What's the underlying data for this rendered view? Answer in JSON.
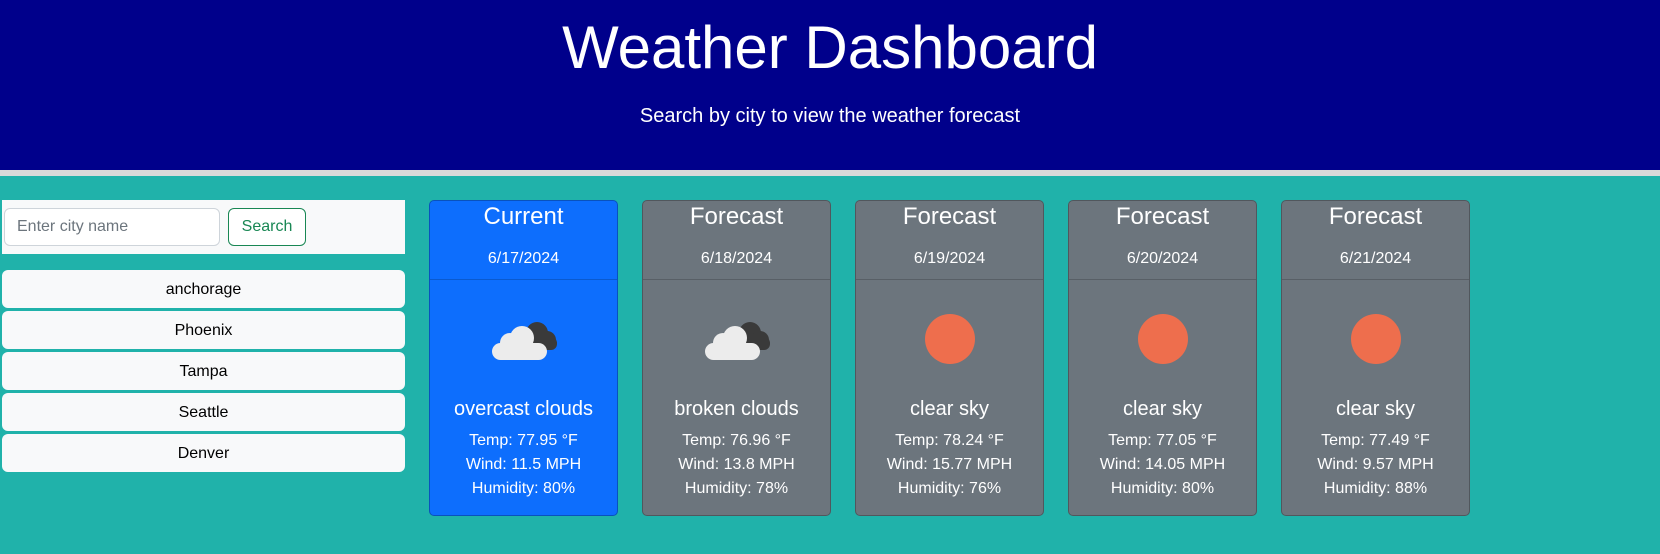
{
  "header": {
    "title": "Weather Dashboard",
    "subtitle": "Search by city to view the weather forecast",
    "background_color": "#00008b"
  },
  "search": {
    "placeholder": "Enter city name",
    "value": "",
    "button_label": "Search"
  },
  "history": [
    "anchorage",
    "Phoenix",
    "Tampa",
    "Seattle",
    "Denver"
  ],
  "cards": [
    {
      "label": "Current",
      "date": "6/17/2024",
      "icon": "overcast-clouds-icon",
      "description": "overcast clouds",
      "temp": "Temp: 77.95 °F",
      "wind": "Wind: 11.5 MPH",
      "humidity": "Humidity: 80%"
    },
    {
      "label": "Forecast",
      "date": "6/18/2024",
      "icon": "broken-clouds-icon",
      "description": "broken clouds",
      "temp": "Temp: 76.96 °F",
      "wind": "Wind: 13.8 MPH",
      "humidity": "Humidity: 78%"
    },
    {
      "label": "Forecast",
      "date": "6/19/2024",
      "icon": "sun-icon",
      "description": "clear sky",
      "temp": "Temp: 78.24 °F",
      "wind": "Wind: 15.77 MPH",
      "humidity": "Humidity: 76%"
    },
    {
      "label": "Forecast",
      "date": "6/20/2024",
      "icon": "sun-icon",
      "description": "clear sky",
      "temp": "Temp: 77.05 °F",
      "wind": "Wind: 14.05 MPH",
      "humidity": "Humidity: 80%"
    },
    {
      "label": "Forecast",
      "date": "6/21/2024",
      "icon": "sun-icon",
      "description": "clear sky",
      "temp": "Temp: 77.49 °F",
      "wind": "Wind: 9.57 MPH",
      "humidity": "Humidity: 88%"
    }
  ],
  "colors": {
    "page_background": "#20b2aa",
    "current_card": "#0d6efd",
    "forecast_card": "#6c757d",
    "sun": "#ee6e4d",
    "search_button": "#198754"
  }
}
